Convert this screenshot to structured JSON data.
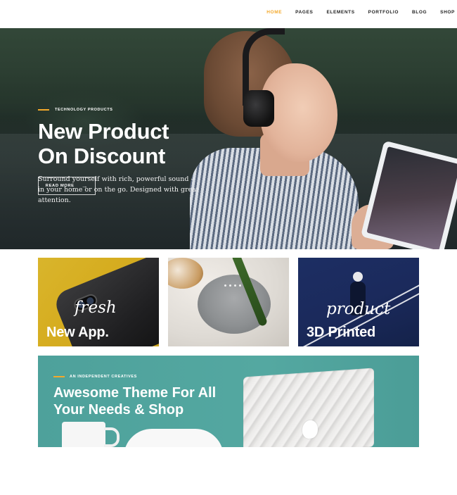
{
  "nav": {
    "items": [
      {
        "label": "HOME",
        "active": true
      },
      {
        "label": "PAGES",
        "active": false
      },
      {
        "label": "ELEMENTS",
        "active": false
      },
      {
        "label": "PORTFOLIO",
        "active": false
      },
      {
        "label": "BLOG",
        "active": false
      },
      {
        "label": "SHOP",
        "active": false
      }
    ],
    "active_color": "#f3a92b"
  },
  "hero": {
    "eyebrow": "TECHNOLOGY PRODUCTS",
    "title_line1": "New Product",
    "title_line2": "On Discount",
    "description": "Surround yourself with rich, powerful sound – in your home or on the go. Designed with great attention.",
    "button_label": "READ MORE",
    "button_icon": "arrow-right-icon"
  },
  "cards": [
    {
      "script": "fresh",
      "title": "New App."
    },
    {
      "script": "",
      "title": ""
    },
    {
      "script": "product",
      "title": "3D Printed"
    }
  ],
  "banner": {
    "eyebrow": "AN INDEPENDENT CREATIVES",
    "title_line1": "Awesome Theme For All",
    "title_line2": "Your Needs & Shop",
    "bg_color": "#4ea19b"
  },
  "colors": {
    "accent": "#f3a92b",
    "banner": "#4ea19b"
  }
}
